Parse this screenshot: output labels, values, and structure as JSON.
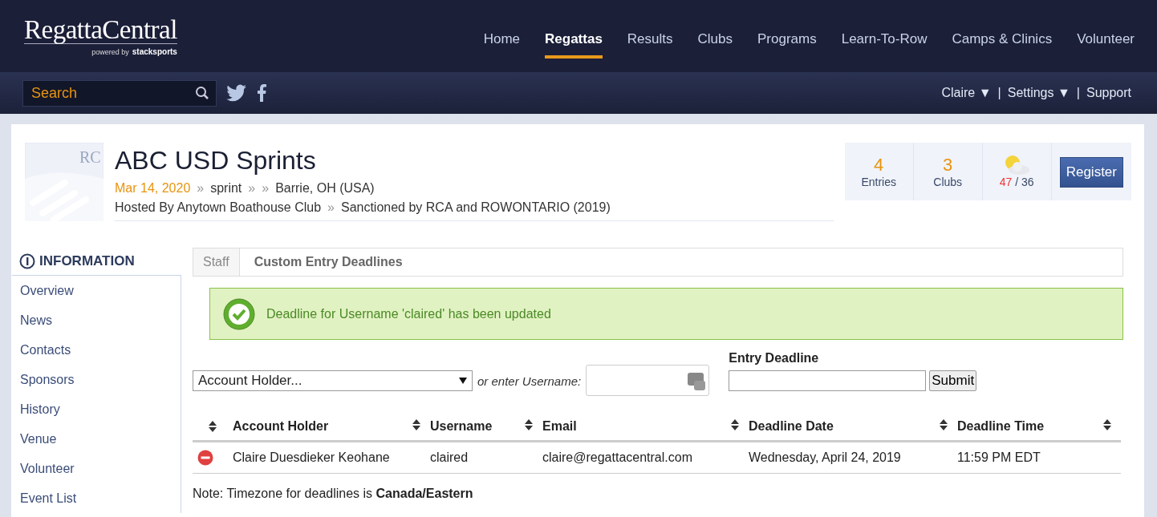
{
  "logo": {
    "name": "RegattaCentral",
    "tagline": "powered by",
    "partner": "stacksports"
  },
  "nav": [
    {
      "label": "Home",
      "selected": false
    },
    {
      "label": "Regattas",
      "selected": true
    },
    {
      "label": "Results",
      "selected": false
    },
    {
      "label": "Clubs",
      "selected": false
    },
    {
      "label": "Programs",
      "selected": false
    },
    {
      "label": "Learn-To-Row",
      "selected": false
    },
    {
      "label": "Camps & Clinics",
      "selected": false
    },
    {
      "label": "Volunteer",
      "selected": false
    }
  ],
  "search": {
    "placeholder": "Search"
  },
  "user_menu": [
    {
      "label": "Claire ▼"
    },
    {
      "label": "Settings ▼"
    },
    {
      "label": "Support"
    }
  ],
  "separator": "|",
  "regatta": {
    "title": "ABC USD Sprints",
    "date": "Mar 14, 2020",
    "type": "sprint",
    "location": "Barrie, OH (USA)",
    "host": "Hosted By Anytown Boathouse Club",
    "sanction": "Sanctioned by RCA and ROWONTARIO (2019)",
    "chevron": "»",
    "logo_text": "RC"
  },
  "stats": [
    {
      "value": "4",
      "label": "Entries"
    },
    {
      "value": "3",
      "label": "Clubs"
    }
  ],
  "weather": {
    "high": "47",
    "low": "/ 36"
  },
  "register_button": "Register",
  "sidebar": {
    "title": "INFORMATION",
    "items": [
      {
        "label": "Overview"
      },
      {
        "label": "News"
      },
      {
        "label": "Contacts"
      },
      {
        "label": "Sponsors"
      },
      {
        "label": "History"
      },
      {
        "label": "Venue"
      },
      {
        "label": "Volunteer"
      },
      {
        "label": "Event List"
      }
    ]
  },
  "breadcrumb": [
    "Staff",
    "Custom Entry Deadlines"
  ],
  "alert": "Deadline for Username 'claired' has been updated",
  "form": {
    "account_select": "Account Holder...",
    "or_label": "or enter Username:",
    "deadline_label": "Entry Deadline",
    "submit": "Submit"
  },
  "table": {
    "columns": [
      "Account Holder",
      "Username",
      "Email",
      "Deadline Date",
      "Deadline Time"
    ],
    "rows": [
      {
        "cells": [
          "Claire Duesdieker Keohane",
          "claired",
          "claire@regattacentral.com",
          "Wednesday, April 24, 2019",
          "11:59 PM EDT"
        ]
      }
    ]
  },
  "note": "Note: Timezone for deadlines is **Canada/Eastern**"
}
